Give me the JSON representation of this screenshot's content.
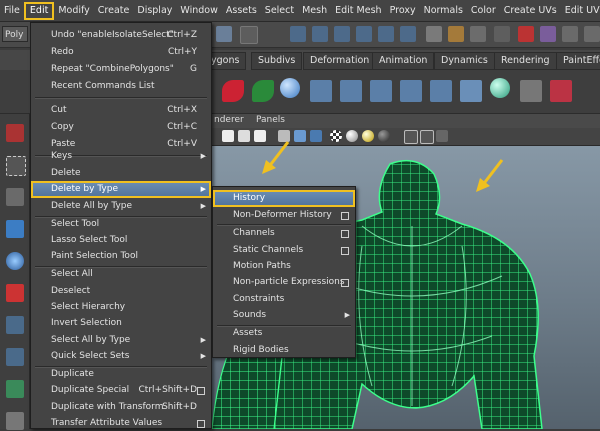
{
  "menubar": {
    "items": [
      "File",
      "Edit",
      "Modify",
      "Create",
      "Display",
      "Window",
      "Assets",
      "Select",
      "Mesh",
      "Edit Mesh",
      "Proxy",
      "Normals",
      "Color",
      "Create UVs",
      "Edit UV"
    ],
    "active": "Edit"
  },
  "toolbar": {
    "mode_label": "Poly"
  },
  "shelf": {
    "tabs": [
      "ygons",
      "Subdivs",
      "Deformation",
      "Animation",
      "Dynamics",
      "Rendering",
      "PaintEffe"
    ]
  },
  "viewport": {
    "menus": [
      "nderer",
      "Panels"
    ]
  },
  "edit_menu": {
    "items": [
      {
        "label": "Undo \"enableIsolateSelect\"",
        "shortcut": "Ctrl+Z"
      },
      {
        "label": "Redo",
        "shortcut": "Ctrl+Y"
      },
      {
        "label": "Repeat \"CombinePolygons\"",
        "shortcut": "G"
      },
      {
        "label": "Recent Commands List"
      },
      {
        "label": "Cut",
        "shortcut": "Ctrl+X"
      },
      {
        "label": "Copy",
        "shortcut": "Ctrl+C"
      },
      {
        "label": "Paste",
        "shortcut": "Ctrl+V"
      },
      {
        "label": "Keys",
        "submenu": true
      },
      {
        "label": "Delete"
      },
      {
        "label": "Delete by Type",
        "submenu": true,
        "highlighted": true
      },
      {
        "label": "Delete All by Type",
        "submenu": true
      },
      {
        "label": "Select Tool"
      },
      {
        "label": "Lasso Select Tool"
      },
      {
        "label": "Paint Selection Tool"
      },
      {
        "label": "Select All"
      },
      {
        "label": "Deselect"
      },
      {
        "label": "Select Hierarchy"
      },
      {
        "label": "Invert Selection"
      },
      {
        "label": "Select All by Type",
        "submenu": true
      },
      {
        "label": "Quick Select Sets",
        "submenu": true
      },
      {
        "label": "Duplicate"
      },
      {
        "label": "Duplicate Special",
        "shortcut": "Ctrl+Shift+D",
        "option": true
      },
      {
        "label": "Duplicate with Transform",
        "shortcut": "Shift+D"
      },
      {
        "label": "Transfer Attribute Values",
        "option": true
      }
    ]
  },
  "delete_by_type_menu": {
    "items": [
      {
        "label": "History",
        "highlighted": true
      },
      {
        "label": "Non-Deformer History",
        "option": true
      },
      {
        "label": "Channels",
        "option": true
      },
      {
        "label": "Static Channels",
        "option": true
      },
      {
        "label": "Motion Paths"
      },
      {
        "label": "Non-particle Expressions",
        "option": true
      },
      {
        "label": "Constraints"
      },
      {
        "label": "Sounds",
        "submenu": true
      },
      {
        "label": "Assets"
      },
      {
        "label": "Rigid Bodies"
      }
    ]
  },
  "colors": {
    "highlight_outline": "#f0c020",
    "menu_highlight": "#5b7ea6",
    "wireframe": "#33ff88"
  }
}
